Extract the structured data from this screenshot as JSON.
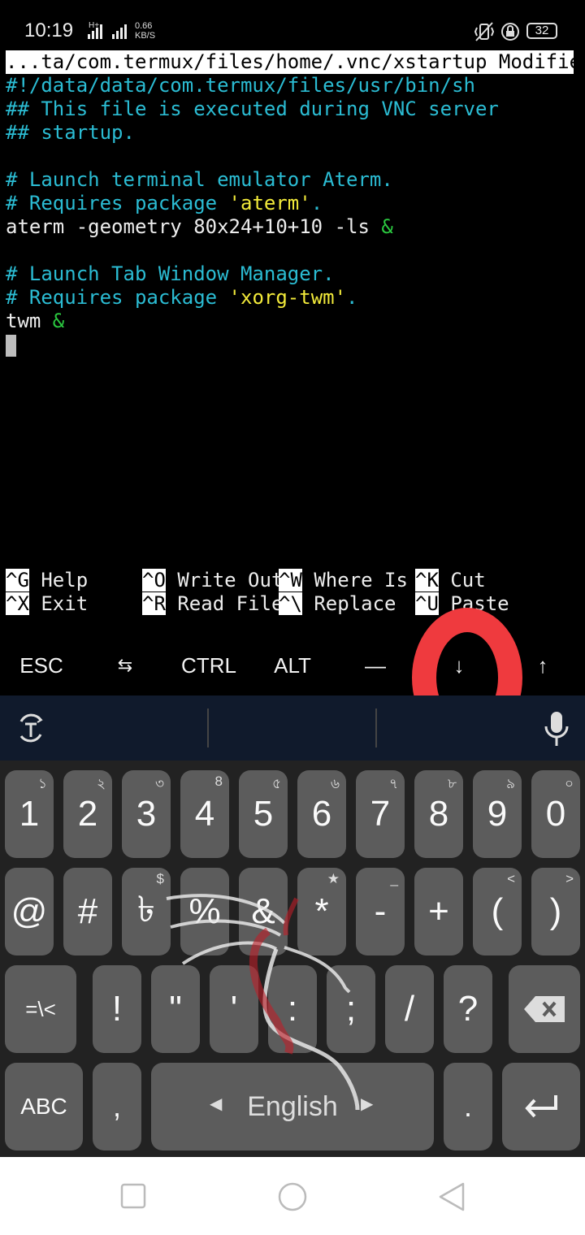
{
  "status_bar": {
    "time": "10:19",
    "net_type": "H+",
    "net_speed": "0.66",
    "net_speed_unit": "KB/S",
    "battery": "32",
    "icons": [
      "hd-icon",
      "signal-icon",
      "vibrate-icon",
      "lock-rotation-icon",
      "battery-icon"
    ]
  },
  "editor": {
    "title": "...ta/com.termux/files/home/.vnc/xstartup Modified",
    "lines": [
      "#!/data/data/com.termux/files/usr/bin/sh",
      "## This file is executed during VNC server",
      "## startup.",
      "",
      "# Launch terminal emulator Aterm.",
      "# Requires package ",
      "'aterm'",
      ".",
      "aterm -geometry 80x24+10+10 -ls ",
      "&",
      "",
      "# Launch Tab Window Manager.",
      "# Requires package ",
      "'xorg-twm'",
      ".",
      "twm ",
      "&"
    ]
  },
  "shortcuts": [
    {
      "key": "^G",
      "label": " Help"
    },
    {
      "key": "^O",
      "label": " Write Out"
    },
    {
      "key": "^W",
      "label": " Where Is"
    },
    {
      "key": "^K",
      "label": " Cut"
    },
    {
      "key": "^X",
      "label": " Exit"
    },
    {
      "key": "^R",
      "label": " Read File"
    },
    {
      "key": "^\\",
      "label": " Replace"
    },
    {
      "key": "^U",
      "label": " Paste"
    }
  ],
  "extra_keys": [
    "ESC",
    "⇆",
    "CTRL",
    "ALT",
    "—",
    "↓",
    "↑"
  ],
  "keyboard": {
    "row1": [
      {
        "label": "1",
        "hint": "১"
      },
      {
        "label": "2",
        "hint": "২"
      },
      {
        "label": "3",
        "hint": "৩"
      },
      {
        "label": "4",
        "hint": "8"
      },
      {
        "label": "5",
        "hint": "৫"
      },
      {
        "label": "6",
        "hint": "৬"
      },
      {
        "label": "7",
        "hint": "৭"
      },
      {
        "label": "8",
        "hint": "৮"
      },
      {
        "label": "9",
        "hint": "৯"
      },
      {
        "label": "0",
        "hint": "০"
      }
    ],
    "row2": [
      {
        "label": "@",
        "hint": ""
      },
      {
        "label": "#",
        "hint": ""
      },
      {
        "label": "৳",
        "hint": "$"
      },
      {
        "label": "%",
        "hint": ""
      },
      {
        "label": "&",
        "hint": ""
      },
      {
        "label": "*",
        "hint": "★"
      },
      {
        "label": "-",
        "hint": "_"
      },
      {
        "label": "+",
        "hint": ""
      },
      {
        "label": "(",
        "hint": "<"
      },
      {
        "label": ")",
        "hint": ">"
      }
    ],
    "row3": [
      {
        "label": "=\\<"
      },
      {
        "label": "!"
      },
      {
        "label": "\""
      },
      {
        "label": "'"
      },
      {
        "label": ":"
      },
      {
        "label": ";"
      },
      {
        "label": "/"
      },
      {
        "label": "?"
      }
    ],
    "abc": "ABC",
    "comma": ",",
    "space": "English",
    "period": ".",
    "enter_icon": "enter-icon",
    "backspace_icon": "backspace-icon"
  },
  "nav": [
    "recent-apps-icon",
    "home-icon",
    "back-icon"
  ],
  "colors": {
    "comment": "#2bbcd3",
    "string": "#f2ea3a",
    "ampersand": "#2bc940",
    "highlight_circle": "#ef3a3e",
    "key_bg": "#5c5c5c",
    "keyboard_bg": "#222222",
    "suggest_bg": "#101a2c"
  }
}
